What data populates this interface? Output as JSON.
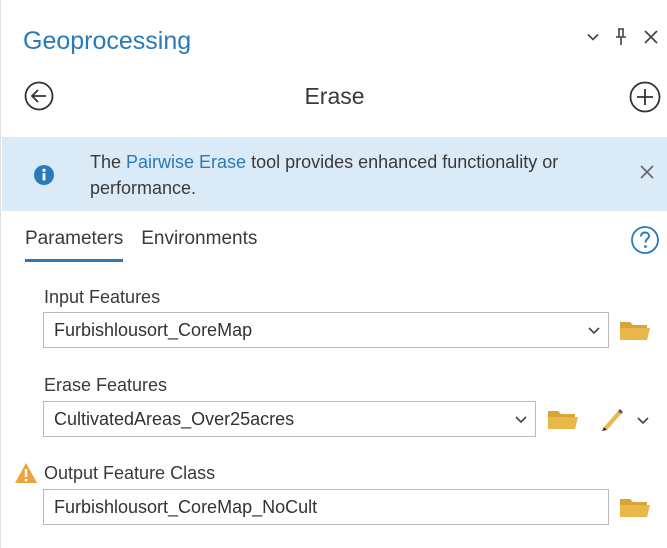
{
  "pane": {
    "title": "Geoprocessing",
    "tool_title": "Erase"
  },
  "banner": {
    "text_pre": "The ",
    "link": "Pairwise Erase",
    "text_post": " tool provides enhanced functionality or performance."
  },
  "tabs": [
    {
      "label": "Parameters",
      "active": true
    },
    {
      "label": "Environments",
      "active": false
    }
  ],
  "params": {
    "input_features": {
      "label": "Input Features",
      "value": "Furbishlousort_CoreMap"
    },
    "erase_features": {
      "label": "Erase Features",
      "value": "CultivatedAreas_Over25acres"
    },
    "output_feature_class": {
      "label": "Output Feature Class",
      "value": "Furbishlousort_CoreMap_NoCult",
      "warning": true
    }
  },
  "icons": {
    "options": "chevron-down-icon",
    "pin": "pin-icon",
    "close": "close-icon",
    "back": "back-arrow-icon",
    "add": "add-icon",
    "info": "info-icon",
    "help": "help-icon",
    "folder": "folder-icon",
    "pencil": "pencil-icon",
    "warning": "warning-icon"
  },
  "colors": {
    "accent": "#2a7ab8",
    "banner_bg": "#dbeaf7",
    "folder": "#e8b84a",
    "warning": "#f0a13c"
  }
}
